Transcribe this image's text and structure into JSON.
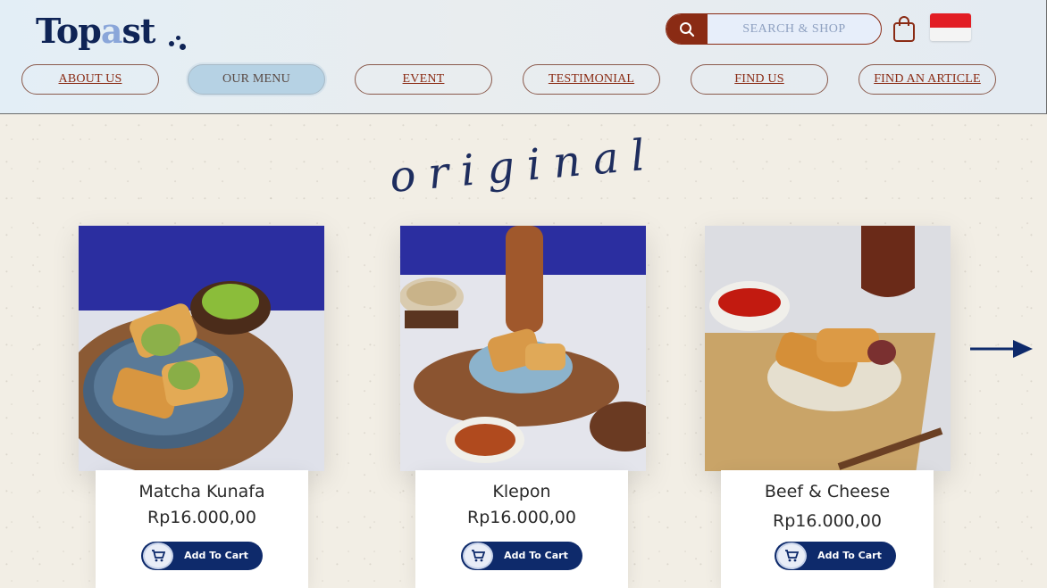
{
  "brand": {
    "logo_text_1": "Top",
    "logo_text_a": "a",
    "logo_text_2": "st"
  },
  "search": {
    "placeholder": "SEARCH & SHOP"
  },
  "nav": {
    "items": [
      {
        "label": "ABOUT US",
        "active": false
      },
      {
        "label": "OUR MENU",
        "active": true
      },
      {
        "label": "EVENT",
        "active": false
      },
      {
        "label": "TESTIMONIAL",
        "active": false
      },
      {
        "label": "FIND US",
        "active": false
      },
      {
        "label": "FIND AN ARTICLE",
        "active": false
      }
    ]
  },
  "section": {
    "title": "original"
  },
  "products": [
    {
      "name": "Matcha Kunafa",
      "price": "Rp16.000,00",
      "button": "Add To Cart"
    },
    {
      "name": "Klepon",
      "price": "Rp16.000,00",
      "button": "Add To Cart"
    },
    {
      "name": "Beef & Cheese",
      "price": "Rp16.000,00",
      "button": "Add To Cart"
    }
  ],
  "colors": {
    "brand_navy": "#0f2456",
    "accent_brown": "#8a2b14",
    "active_tab": "#b6d2e4",
    "button_navy": "#0e2a6b"
  },
  "icons": [
    "search-icon",
    "shopping-bag-icon",
    "indonesia-flag-icon",
    "cart-icon",
    "arrow-right-icon"
  ]
}
